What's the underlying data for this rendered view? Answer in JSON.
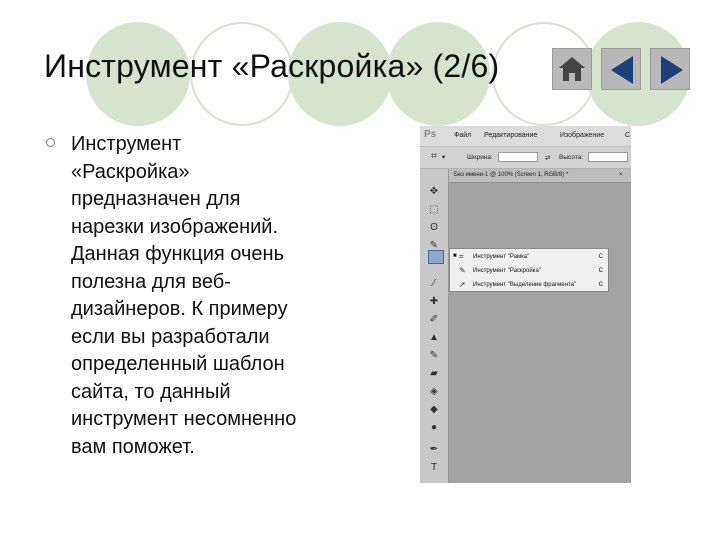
{
  "slide": {
    "title": "Инструмент «Раскройка» (2/6)",
    "body_lines": [
      "Инструмент",
      "«Раскройка»",
      "предназначен для",
      "нарезки изображений.",
      "Данная функция очень",
      "полезна для веб-",
      "дизайнеров. К примеру",
      "если вы разработали",
      "определенный шаблон",
      "сайта, то данный",
      "инструмент несомненно",
      "вам поможет."
    ]
  },
  "nav": {
    "home_icon": "home-icon",
    "prev_icon": "triangle-left-icon",
    "next_icon": "triangle-right-icon"
  },
  "photoshop": {
    "logo": "Ps",
    "menu": [
      "Файл",
      "Редактирование",
      "Изображение",
      "С"
    ],
    "options": {
      "width_label": "Ширина:",
      "height_label": "Высота:"
    },
    "tab_title": "Без имени-1 @ 100% (Screen 1, RGB/8) *",
    "flyout": [
      {
        "label": "Инструмент \"Рамка\"",
        "key": "C",
        "active": true
      },
      {
        "label": "Инструмент \"Раскройка\"",
        "key": "C",
        "active": false
      },
      {
        "label": "Инструмент \"Выделение фрагмента\"",
        "key": "C",
        "active": false
      }
    ]
  },
  "colors": {
    "circle_green": "#d7e4cd",
    "nav_arrow": "#1f3f7a",
    "nav_button": "#b8b8b8"
  }
}
